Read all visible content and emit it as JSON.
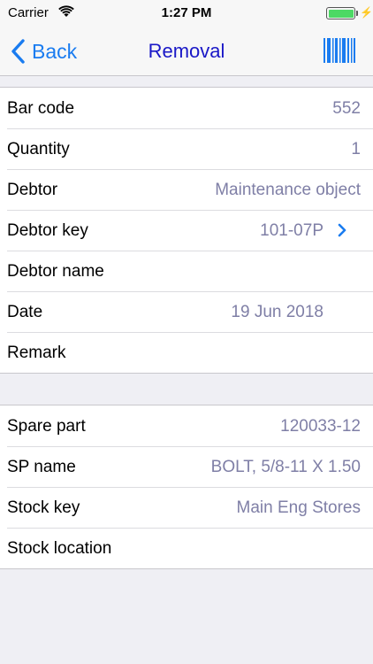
{
  "status_bar": {
    "carrier": "Carrier",
    "time": "1:27 PM",
    "battery_level": 1.0
  },
  "nav": {
    "back_label": "Back",
    "title": "Removal",
    "back_icon": "chevron-left-icon",
    "right_icon": "barcode-icon"
  },
  "sections": [
    {
      "rows": [
        {
          "label": "Bar code",
          "value": "552"
        },
        {
          "label": "Quantity",
          "value": "1"
        },
        {
          "label": "Debtor",
          "value": "Maintenance object"
        },
        {
          "label": "Debtor key",
          "value": "101-07P"
        },
        {
          "label": "Debtor name",
          "value": ""
        },
        {
          "label": "Date",
          "value": "19 Jun 2018"
        },
        {
          "label": "Remark",
          "value": ""
        }
      ]
    },
    {
      "rows": [
        {
          "label": "Spare part",
          "value": "120033-12"
        },
        {
          "label": "SP name",
          "value": "BOLT, 5/8-11 X 1.50"
        },
        {
          "label": "Stock key",
          "value": "Main Eng Stores"
        },
        {
          "label": "Stock location",
          "value": ""
        }
      ]
    }
  ],
  "colors": {
    "tint": "#1a7cf0",
    "title": "#1a18c7",
    "value_text": "#7f7fa6",
    "background": "#efeff4",
    "battery": "#4cd964"
  }
}
